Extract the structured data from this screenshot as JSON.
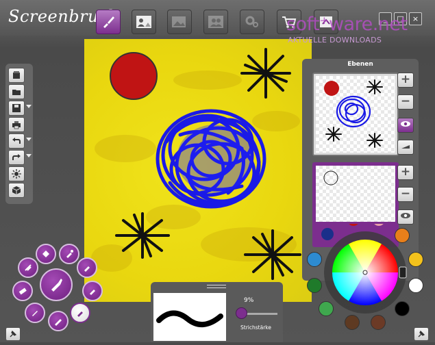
{
  "app": {
    "logo_text": "Screenbrush"
  },
  "toolbar": {
    "buttons": [
      {
        "icon": "brush-icon",
        "active": true
      },
      {
        "icon": "photo-person-icon",
        "active": false
      },
      {
        "icon": "gallery-icon",
        "active": false
      },
      {
        "icon": "people-icon",
        "active": false
      },
      {
        "icon": "settings-gears-icon",
        "active": false
      },
      {
        "icon": "cart-icon",
        "active": false
      },
      {
        "icon": "share-icon",
        "active": false
      }
    ]
  },
  "window_controls": [
    "_",
    "□",
    "×"
  ],
  "watermark": {
    "main": "soft⁺ware.net",
    "sub": "AKTUELLE DOWNLOADS"
  },
  "layers": {
    "title": "Ebenen",
    "add_label": "+",
    "remove_label": "−"
  },
  "brush": {
    "size_percent": "9%",
    "size_value": 0.09,
    "size_label": "Strichstärke"
  },
  "colors": {
    "accent": "#7c2e8e",
    "canvas": "#ecdc13",
    "swatches": [
      "#2d8bd0",
      "#e87f1a",
      "#f4c21c",
      "#ffffff",
      "#000000",
      "#6b3a26",
      "#1f7a2a",
      "#5e3a22",
      "#a5542e",
      "#3fa84e"
    ]
  },
  "tools": [
    "fill-tool-icon",
    "dropper-icon",
    "marker-icon",
    "brush-tool-icon",
    "eraser-icon",
    "crayon-icon",
    "pen-icon",
    "stencil-icon",
    "pencil-icon",
    "highlighter-icon"
  ]
}
